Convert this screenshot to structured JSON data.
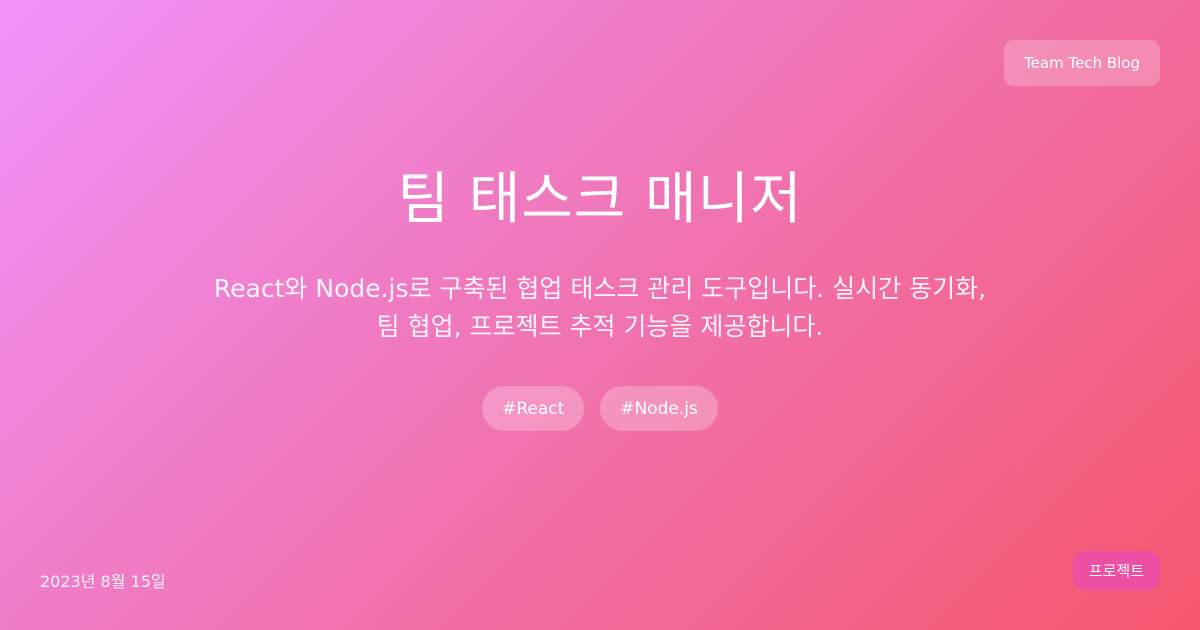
{
  "blog": {
    "name": "Team Tech Blog"
  },
  "post": {
    "title": "팀 태스크 매니저",
    "description": "React와 Node.js로 구축된 협업 태스크 관리 도구입니다. 실시간 동기화, 팀 협업, 프로젝트 추적 기능을 제공합니다.",
    "tags": [
      "#React",
      "#Node.js"
    ],
    "date": "2023년 8월 15일",
    "category": "프로젝트"
  },
  "colors": {
    "gradient_start": "#f093fb",
    "gradient_end": "#f5576c",
    "category_badge": "#ec4fa3",
    "text": "#ffffff"
  }
}
